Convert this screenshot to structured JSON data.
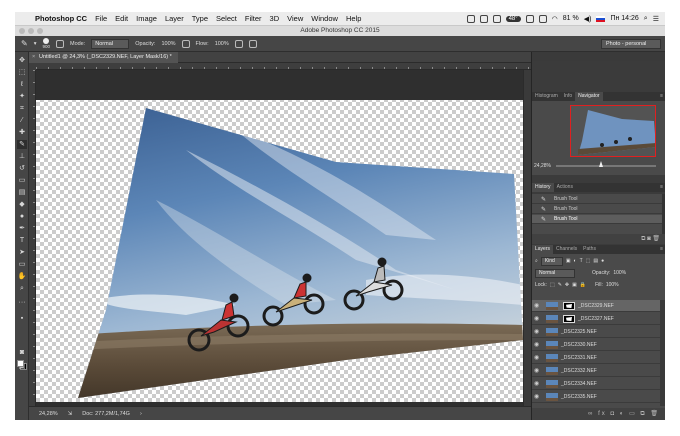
{
  "menubar": {
    "app": "Photoshop CC",
    "items": [
      "File",
      "Edit",
      "Image",
      "Layer",
      "Type",
      "Select",
      "Filter",
      "3D",
      "View",
      "Window",
      "Help"
    ],
    "temperature": "48°",
    "battery": "81 %",
    "clock": "Пн 14:26"
  },
  "window": {
    "title": "Adobe Photoshop CC 2015"
  },
  "options": {
    "brush_size": "900",
    "mode_label": "Mode:",
    "mode_value": "Normal",
    "opacity_label": "Opacity:",
    "opacity_value": "100%",
    "flow_label": "Flow:",
    "flow_value": "100%",
    "workspace": "Photo - personal"
  },
  "document": {
    "tab_title": "Untitled1 @ 24,3% (_DSC2329.NEF, Layer Mask/16) *",
    "close_glyph": "×"
  },
  "status": {
    "zoom": "24,28%",
    "doc_size": "Doc: 277,2M/1,74G"
  },
  "navigator": {
    "tabs": [
      "Histogram",
      "Info",
      "Navigator"
    ],
    "active": "Navigator",
    "zoom": "24,28%",
    "view_fraction": 1
  },
  "history": {
    "tabs": [
      "History",
      "Actions"
    ],
    "active": "History",
    "items": [
      "Brush Tool",
      "Brush Tool",
      "Brush Tool"
    ],
    "selected_index": 2
  },
  "layers": {
    "tabs": [
      "Layers",
      "Channels",
      "Paths"
    ],
    "active": "Layers",
    "kind_label": "Kind",
    "blend_mode": "Normal",
    "opacity_label": "Opacity:",
    "opacity_value": "100%",
    "lock_label": "Lock:",
    "fill_label": "Fill:",
    "fill_value": "100%",
    "items": [
      {
        "name": "_DSC2329.NEF",
        "mask": true,
        "selected": true
      },
      {
        "name": "_DSC2327.NEF",
        "mask": true,
        "selected": false
      },
      {
        "name": "_DSC2325.NEF",
        "mask": false,
        "selected": false
      },
      {
        "name": "_DSC2330.NEF",
        "mask": false,
        "selected": false
      },
      {
        "name": "_DSC2331.NEF",
        "mask": false,
        "selected": false
      },
      {
        "name": "_DSC2332.NEF",
        "mask": false,
        "selected": false
      },
      {
        "name": "_DSC2334.NEF",
        "mask": false,
        "selected": false
      },
      {
        "name": "_DSC2335.NEF",
        "mask": false,
        "selected": false
      }
    ]
  },
  "colors": {
    "ui_bg": "#535353",
    "panel_bg": "#4a4a4a",
    "navigator_frame": "#e02020",
    "foreground": "#ffffff",
    "background": "#000000"
  }
}
